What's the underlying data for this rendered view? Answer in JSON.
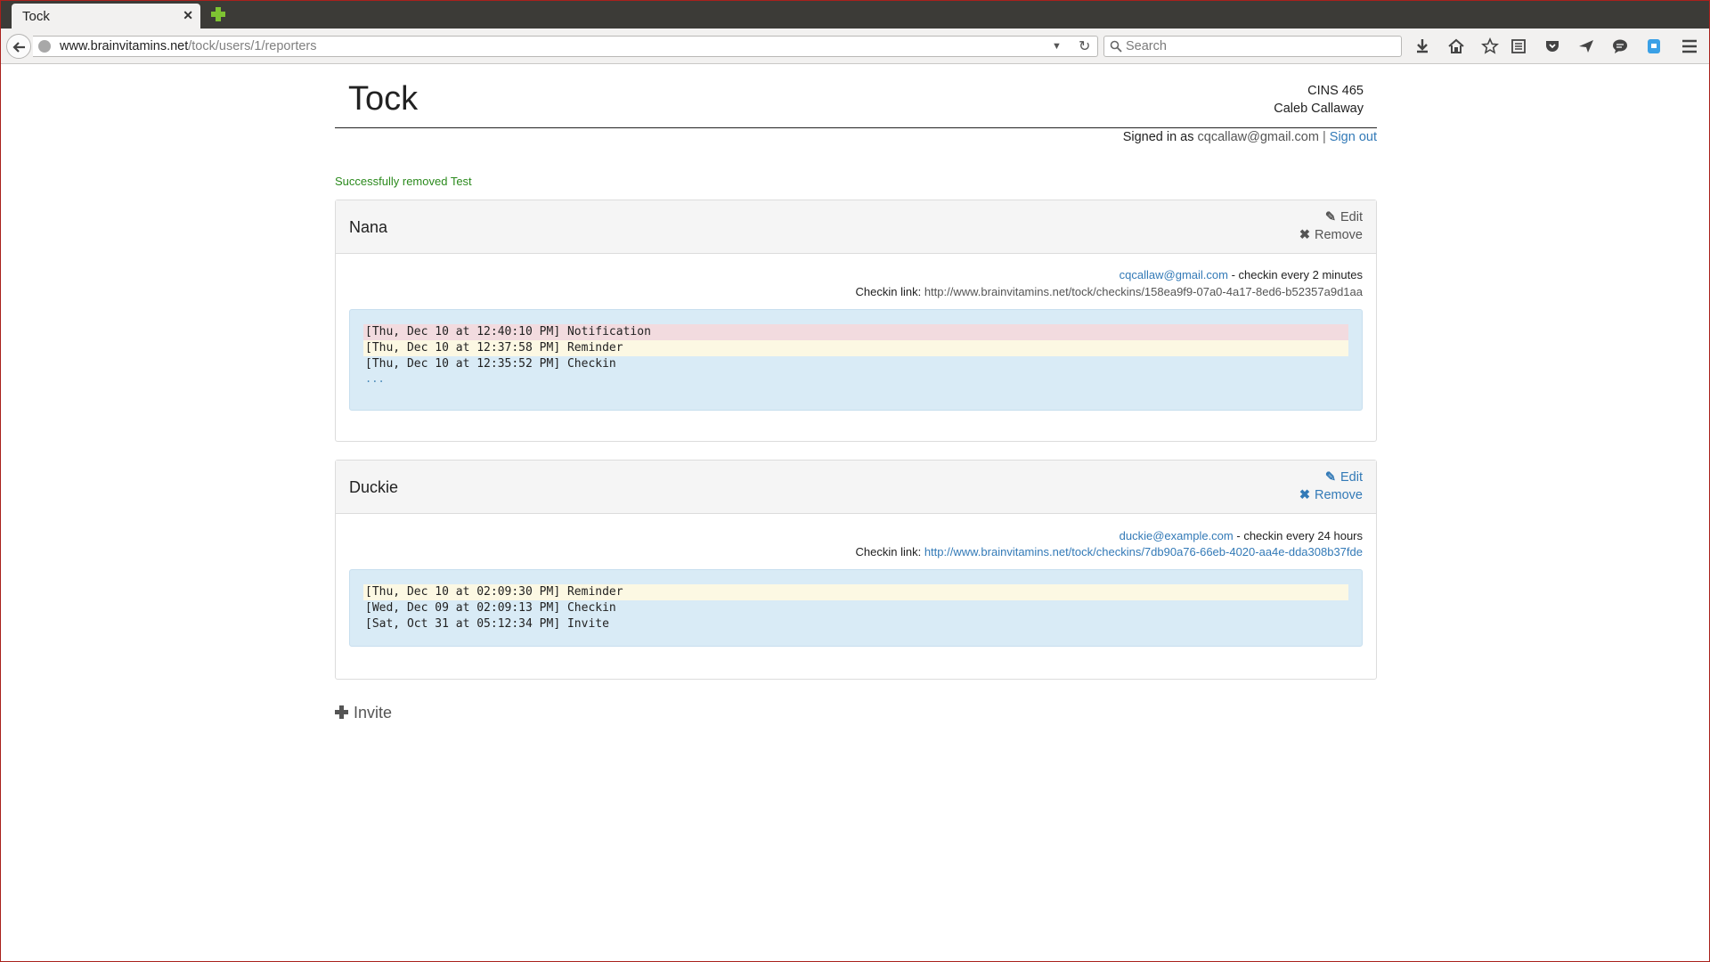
{
  "browser": {
    "tab_title": "Tock",
    "url_domain": "www.brainvitamins.net",
    "url_path": "/tock/users/1/reporters",
    "search_placeholder": "Search"
  },
  "header": {
    "brand": "Tock",
    "course": "CINS 465",
    "user_name": "Caleb Callaway",
    "signed_in_prefix": "Signed in as",
    "signed_in_email": "cqcallaw@gmail.com",
    "separator": "|",
    "sign_out": "Sign out"
  },
  "flash": "Successfully removed Test",
  "reporters": [
    {
      "name": "Nana",
      "edit_label": "Edit",
      "remove_label": "Remove",
      "email": "cqcallaw@gmail.com",
      "frequency": "- checkin every 2 minutes",
      "checkin_label": "Checkin link:",
      "checkin_link": "http://www.brainvitamins.net/tock/checkins/158ea9f9-07a0-4a17-8ed6-b52357a9d1aa",
      "log": [
        {
          "text": "[Thu, Dec 10 at 12:40:10 PM] Notification",
          "kind": "notification"
        },
        {
          "text": "[Thu, Dec 10 at 12:37:58 PM] Reminder",
          "kind": "reminder"
        },
        {
          "text": "[Thu, Dec 10 at 12:35:52 PM] Checkin",
          "kind": "checkin"
        }
      ],
      "log_more": "..."
    },
    {
      "name": "Duckie",
      "edit_label": "Edit",
      "remove_label": "Remove",
      "email": "duckie@example.com",
      "frequency": "- checkin every 24 hours",
      "checkin_label": "Checkin link:",
      "checkin_link": "http://www.brainvitamins.net/tock/checkins/7db90a76-66eb-4020-aa4e-dda308b37fde",
      "log": [
        {
          "text": "[Thu, Dec 10 at 02:09:30 PM] Reminder",
          "kind": "reminder"
        },
        {
          "text": "[Wed, Dec 09 at 02:09:13 PM] Checkin",
          "kind": "checkin"
        },
        {
          "text": "[Sat, Oct 31 at 05:12:34 PM] Invite",
          "kind": "invite"
        }
      ]
    }
  ],
  "invite_label": "Invite",
  "colors": {
    "link": "#337ab7",
    "success": "#2b8a1d",
    "log_background": "#d9ebf6",
    "notification_row": "#f2dbdf",
    "reminder_row": "#fcf8e3"
  }
}
